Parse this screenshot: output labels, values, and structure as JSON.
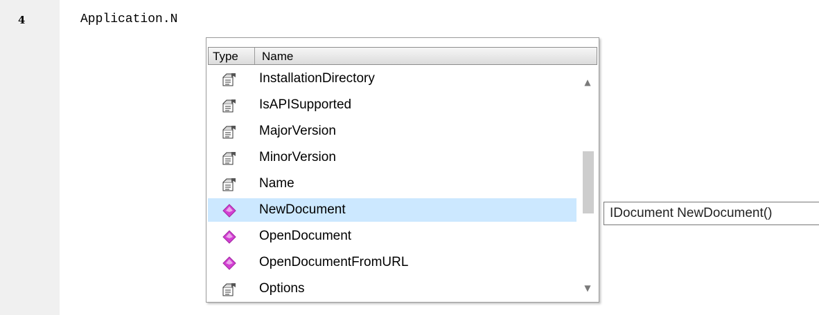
{
  "editor": {
    "line_number": "4",
    "code": "Application.N"
  },
  "autocomplete": {
    "headers": {
      "type": "Type",
      "name": "Name"
    },
    "items": [
      {
        "label": "InstallationDirectory",
        "kind": "property"
      },
      {
        "label": "IsAPISupported",
        "kind": "property"
      },
      {
        "label": "MajorVersion",
        "kind": "property"
      },
      {
        "label": "MinorVersion",
        "kind": "property"
      },
      {
        "label": "Name",
        "kind": "property"
      },
      {
        "label": "NewDocument",
        "kind": "method",
        "selected": true
      },
      {
        "label": "OpenDocument",
        "kind": "method"
      },
      {
        "label": "OpenDocumentFromURL",
        "kind": "method"
      },
      {
        "label": "Options",
        "kind": "property"
      }
    ],
    "icons": {
      "property": "property-icon",
      "method": "method-icon"
    },
    "colors": {
      "selection": "#cce8ff",
      "method_icon": "#d23fd2"
    }
  },
  "tooltip": {
    "text": "IDocument NewDocument()"
  }
}
